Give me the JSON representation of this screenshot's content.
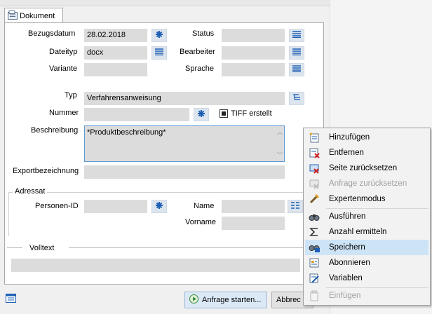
{
  "tab": {
    "label": "Dokument"
  },
  "form": {
    "bezugsdatum": {
      "label": "Bezugsdatum",
      "value": "28.02.2018"
    },
    "status": {
      "label": "Status",
      "value": ""
    },
    "dateityp": {
      "label": "Dateityp",
      "value": "docx"
    },
    "bearbeiter": {
      "label": "Bearbeiter",
      "value": ""
    },
    "variante": {
      "label": "Variante",
      "value": ""
    },
    "sprache": {
      "label": "Sprache",
      "value": ""
    },
    "typ": {
      "label": "Typ",
      "value": "Verfahrensanweisung"
    },
    "nummer": {
      "label": "Nummer",
      "value": ""
    },
    "tiff": {
      "label": "TIFF erstellt",
      "checked": false
    },
    "beschreibung": {
      "label": "Beschreibung",
      "value": "*Produktbeschreibung*"
    },
    "exportbezeichnung": {
      "label": "Exportbezeichnung",
      "value": ""
    }
  },
  "adressat": {
    "legend": "Adressat",
    "personen_id": {
      "label": "Personen-ID",
      "value": ""
    },
    "name": {
      "label": "Name",
      "value": ""
    },
    "vorname": {
      "label": "Vorname",
      "value": ""
    }
  },
  "volltext": {
    "legend": "Volltext",
    "value": ""
  },
  "buttons": {
    "anfrage_starten": "Anfrage starten...",
    "abbrechen": "Abbrec"
  },
  "context_menu": {
    "items": [
      {
        "label": "Hinzufügen",
        "icon": "add-record-icon",
        "enabled": true,
        "selected": false
      },
      {
        "label": "Entfernen",
        "icon": "remove-record-icon",
        "enabled": true,
        "selected": false
      },
      {
        "label": "Seite zurücksetzen",
        "icon": "reset-page-icon",
        "enabled": true,
        "selected": false
      },
      {
        "label": "Anfrage zurücksetzen",
        "icon": "reset-query-icon",
        "enabled": false,
        "selected": false
      },
      {
        "label": "Expertenmodus",
        "icon": "expert-mode-icon",
        "enabled": true,
        "selected": false
      },
      {
        "label": "Ausführen",
        "icon": "binoculars-icon",
        "enabled": true,
        "selected": false
      },
      {
        "label": "Anzahl ermitteln",
        "icon": "sum-icon",
        "enabled": true,
        "selected": false
      },
      {
        "label": "Speichern",
        "icon": "save-query-icon",
        "enabled": true,
        "selected": true
      },
      {
        "label": "Abonnieren",
        "icon": "subscribe-icon",
        "enabled": true,
        "selected": false
      },
      {
        "label": "Variablen",
        "icon": "variables-icon",
        "enabled": true,
        "selected": false
      },
      {
        "label": "Einfügen",
        "icon": "paste-icon",
        "enabled": false,
        "selected": false
      }
    ]
  },
  "colors": {
    "field_bg": "#dcdcdc",
    "accent": "#1d5fb4",
    "menu_highlight": "#cde4f7"
  }
}
